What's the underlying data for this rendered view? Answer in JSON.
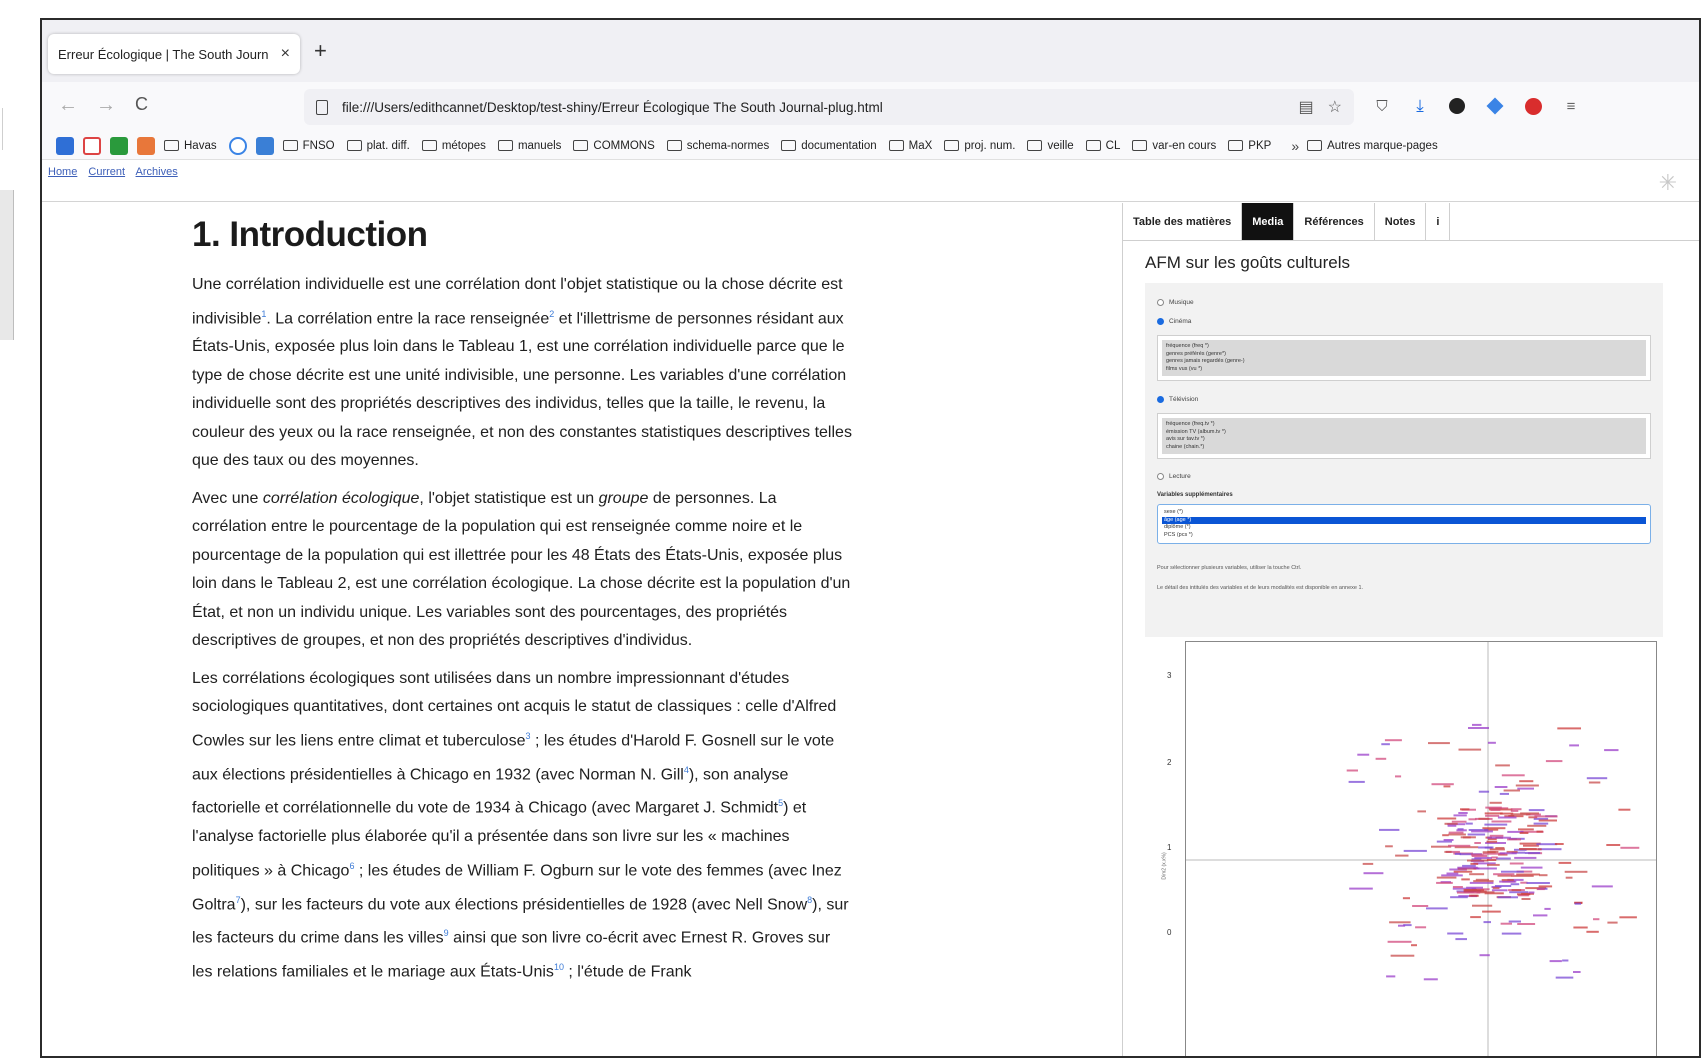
{
  "browser": {
    "tab_title": "Erreur Écologique | The South Journ",
    "tab_close": "×",
    "new_tab": "+",
    "url": "file:///Users/edithcannet/Desktop/test-shiny/Erreur Écologique The South Journal-plug.html",
    "bookmarks": [
      "Havas",
      "FNSO",
      "plat. diff.",
      "métopes",
      "manuels",
      "COMMONS",
      "schema-normes",
      "documentation",
      "MaX",
      "proj. num.",
      "veille",
      "CL",
      "var-en cours",
      "PKP"
    ],
    "bookmarks_more": "Autres marque-pages",
    "chevron": "»",
    "icons": {
      "back": "←",
      "forward": "→",
      "reload": "C",
      "reader": "▤",
      "star": "☆",
      "pocket": "⛉",
      "download": "⤓"
    },
    "colors": {
      "ublock": "#d92d2d",
      "privacy_badger": "#222222",
      "extension_blue": "#3a84e6"
    }
  },
  "site_nav": {
    "links": [
      "Home",
      "Current",
      "Archives"
    ],
    "asterisk": "✳"
  },
  "article": {
    "heading": "1. Introduction",
    "p1": [
      {
        "t": "Une corrélation individuelle est une corrélation dont l'objet statistique ou la chose décrite est indivisible"
      },
      {
        "sup": "1"
      },
      {
        "t": ". La corrélation entre la race renseignée"
      },
      {
        "sup": "2"
      },
      {
        "t": " et l'illettrisme de personnes résidant aux États-Unis, exposée plus loin dans le Tableau 1, est une corrélation individuelle parce que le type de chose décrite est une unité indivisible, une personne. Les variables d'une corrélation individuelle sont des propriétés descriptives des individus, telles que la taille, le revenu, la couleur des yeux ou la race renseignée, et non des constantes statistiques descriptives telles que des taux ou des moyennes."
      }
    ],
    "p2": [
      {
        "t": "Avec une "
      },
      {
        "em": "corrélation écologique"
      },
      {
        "t": ", l'objet statistique est un "
      },
      {
        "em": "groupe"
      },
      {
        "t": " de personnes. La corrélation entre le pourcentage de la population qui est renseignée comme noire et le pourcentage de la population qui est illettrée pour les 48 États des États-Unis, exposée plus loin dans le Tableau 2, est une corrélation écologique. La chose décrite est la population d'un État, et non un individu unique. Les variables sont des pourcentages, des propriétés descriptives de groupes, et non des propriétés descriptives d'individus."
      }
    ],
    "p3": [
      {
        "t": "Les corrélations écologiques sont utilisées dans un nombre impressionnant d'études sociologiques quantitatives, dont certaines ont acquis le statut de classiques : celle d'Alfred Cowles sur les liens entre climat et tuberculose"
      },
      {
        "sup": "3"
      },
      {
        "t": " ; les études d'Harold F. Gosnell sur le vote aux élections présidentielles à Chicago en 1932 (avec Norman N. Gill"
      },
      {
        "sup": "4"
      },
      {
        "t": "), son analyse factorielle et corrélationnelle du vote de 1934 à Chicago (avec Margaret J. Schmidt"
      },
      {
        "sup": "5"
      },
      {
        "t": ") et l'analyse factorielle plus élaborée qu'il a présentée dans son livre sur les « machines politiques » à Chicago"
      },
      {
        "sup": "6"
      },
      {
        "t": " ; les études de William F. Ogburn sur le vote des femmes (avec Inez Goltra"
      },
      {
        "sup": "7"
      },
      {
        "t": "), sur les facteurs du vote aux élections présidentielles de 1928 (avec Nell Snow"
      },
      {
        "sup": "8"
      },
      {
        "t": "), sur les facteurs du crime dans les villes"
      },
      {
        "sup": "9"
      },
      {
        "t": " ainsi que son livre co-écrit avec Ernest R. Groves sur les relations familiales et le mariage aux États-Unis"
      },
      {
        "sup": "10"
      },
      {
        "t": " ; l'étude de Frank"
      }
    ]
  },
  "sidebar": {
    "tabs": [
      "Table des matières",
      "Media",
      "Références",
      "Notes",
      "i"
    ],
    "active_tab": "Media",
    "title": "AFM sur les goûts culturels",
    "panel": {
      "opt1": "Musique",
      "opt2": "Cinéma",
      "list1": [
        "fréquence (freq *)",
        "genres préférés (genre*)",
        "genres jamais regardés (genre-)",
        "films vus (vu *)"
      ],
      "opt3": "Télévision",
      "list2": [
        "fréquence (freq.tv *)",
        "émission TV (album.tv *)",
        "avis sur tav.tv *)",
        "chaine (chain.*)"
      ],
      "opt4": "Lecture",
      "sup_label": "Variables supplémentaires",
      "sup_items": [
        "sexe (*)",
        "âge (age *)",
        "diplôme (*)",
        "PCS (pcs *)"
      ],
      "note1": "Pour sélectionner plusieurs variables, utiliser la touche Ctrl.",
      "note2": "Le détail des intitulés des variables et de leurs modalités est disponible en annexe 1."
    },
    "plot": {
      "y_ticks": [
        "3",
        "2",
        "1",
        "0"
      ],
      "y_label": "Dim2 (x.x%)"
    }
  }
}
